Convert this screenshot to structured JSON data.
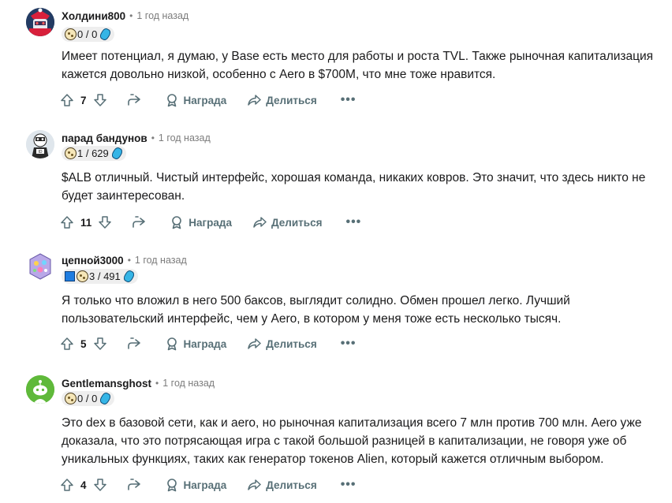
{
  "comments": [
    {
      "author": "Холдини800",
      "separator": "•",
      "time": "1 год назад",
      "flair": {
        "square": false,
        "text": "0 / 0"
      },
      "text": "Имеет потенциал, я думаю, у Base есть место для работы и роста TVL. Также рыночная капитализация кажется довольно низкой, особенно с Aero в $700M, что мне тоже нравится.",
      "votes": "7",
      "award_label": "Награда",
      "share_label": "Делиться",
      "more": "•••"
    },
    {
      "author": "парад бандунов",
      "separator": "•",
      "time": "1 год назад",
      "flair": {
        "square": false,
        "text": "1 / 629"
      },
      "text": "$ALB отличный. Чистый интерфейс, хорошая команда, никаких ковров. Это значит, что здесь никто не будет заинтересован.",
      "votes": "11",
      "award_label": "Награда",
      "share_label": "Делиться",
      "more": "•••"
    },
    {
      "author": "цепной3000",
      "separator": "•",
      "time": "1 год назад",
      "flair": {
        "square": true,
        "text": "3 / 491"
      },
      "text": "Я только что вложил в него 500 баксов, выглядит солидно. Обмен прошел легко. Лучший пользовательский интерфейс, чем у Aero, в котором у меня тоже есть несколько тысяч.",
      "votes": "5",
      "award_label": "Награда",
      "share_label": "Делиться",
      "more": "•••"
    },
    {
      "author": "Gentlemansghost",
      "separator": "•",
      "time": "1 год назад",
      "flair": {
        "square": false,
        "text": "0 / 0"
      },
      "text": "Это dex в базовой сети, как и aero, но рыночная капитализация всего 7 млн против 700 млн. Aero уже доказала, что это потрясающая игра с такой большой разницей в капитализации, не говоря уже об уникальных функциях, таких как генератор токенов Alien, который кажется отличным выбором.",
      "votes": "4",
      "award_label": "Награда",
      "share_label": "Делиться",
      "more": "•••"
    }
  ],
  "colors": {
    "text": "#1a1a1b",
    "meta": "#7c7c7c",
    "action": "#576f76",
    "flair_bg": "#eeeeee",
    "gem": "#35b5e6"
  },
  "icons": [
    "upvote-icon",
    "downvote-icon",
    "reply-icon",
    "award-icon",
    "share-icon",
    "more-icon",
    "coin-icon",
    "gem-icon"
  ]
}
